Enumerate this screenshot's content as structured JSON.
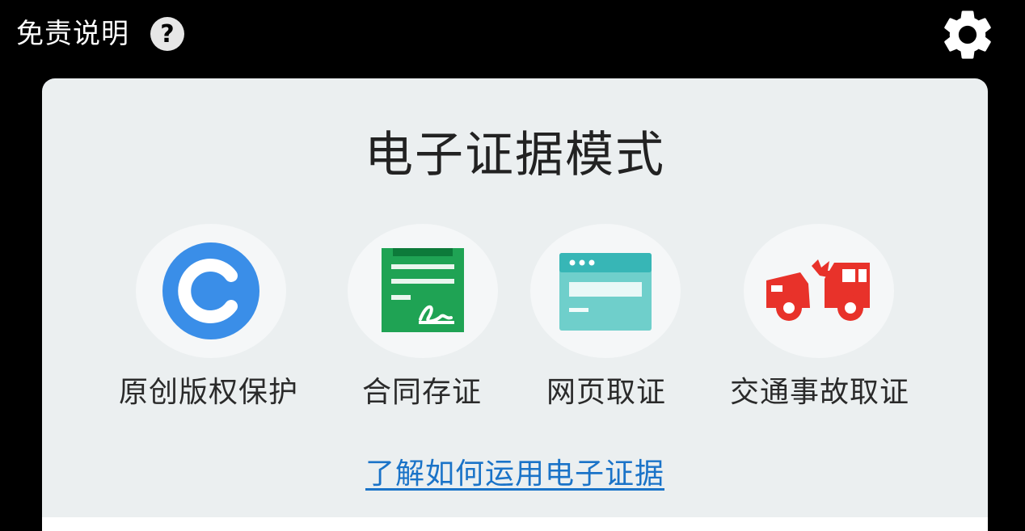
{
  "topbar": {
    "disclaimer_label": "免责说明",
    "help_glyph": "?",
    "settings_icon": "gear-icon"
  },
  "card": {
    "title": "电子证据模式",
    "modes": [
      {
        "label": "原创版权保护",
        "icon": "copyright-icon",
        "color": "#3a8ee8"
      },
      {
        "label": "合同存证",
        "icon": "contract-icon",
        "color": "#1fa354"
      },
      {
        "label": "网页取证",
        "icon": "webpage-icon",
        "color": "#4cc3c0"
      },
      {
        "label": "交通事故取证",
        "icon": "car-crash-icon",
        "color": "#e8322a"
      }
    ],
    "learn_link": "了解如何运用电子证据"
  },
  "colors": {
    "background": "#000000",
    "card": "#ebeff0",
    "link": "#1a73c8"
  }
}
